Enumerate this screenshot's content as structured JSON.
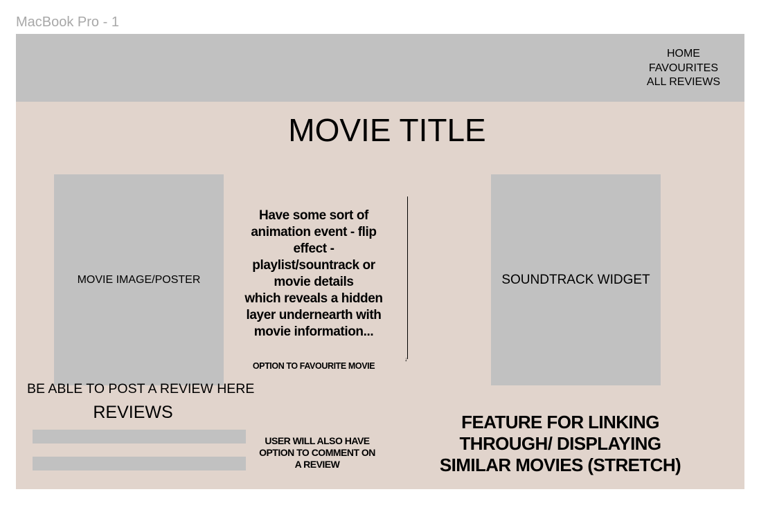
{
  "frame_label": "MacBook Pro - 1",
  "nav": {
    "items": [
      "HOME",
      "FAVOURITES",
      "ALL REVIEWS"
    ]
  },
  "page_title": "MOVIE TITLE",
  "poster_placeholder": "MOVIE IMAGE/POSTER",
  "soundtrack_placeholder": "SOUNDTRACK WIDGET",
  "animation_note": "Have some sort of\nanimation event - flip\neffect -\nplaylist/sountrack or\nmovie details\nwhich reveals a hidden\nlayer undernearth with\nmovie information...",
  "favourite_option": "OPTION TO FAVOURITE MOVIE",
  "post_review": "BE ABLE TO POST A REVIEW HERE",
  "reviews_heading": "REVIEWS",
  "comment_note": "USER WILL ALSO HAVE\nOPTION TO COMMENT ON\nA REVIEW",
  "similar_note": "FEATURE FOR LINKING\nTHROUGH/ DISPLAYING\nSIMILAR MOVIES (STRETCH)",
  "colors": {
    "frame_bg": "#e1d4cc",
    "placeholder": "#c1c1c1",
    "frame_label": "#a8a8a8"
  }
}
